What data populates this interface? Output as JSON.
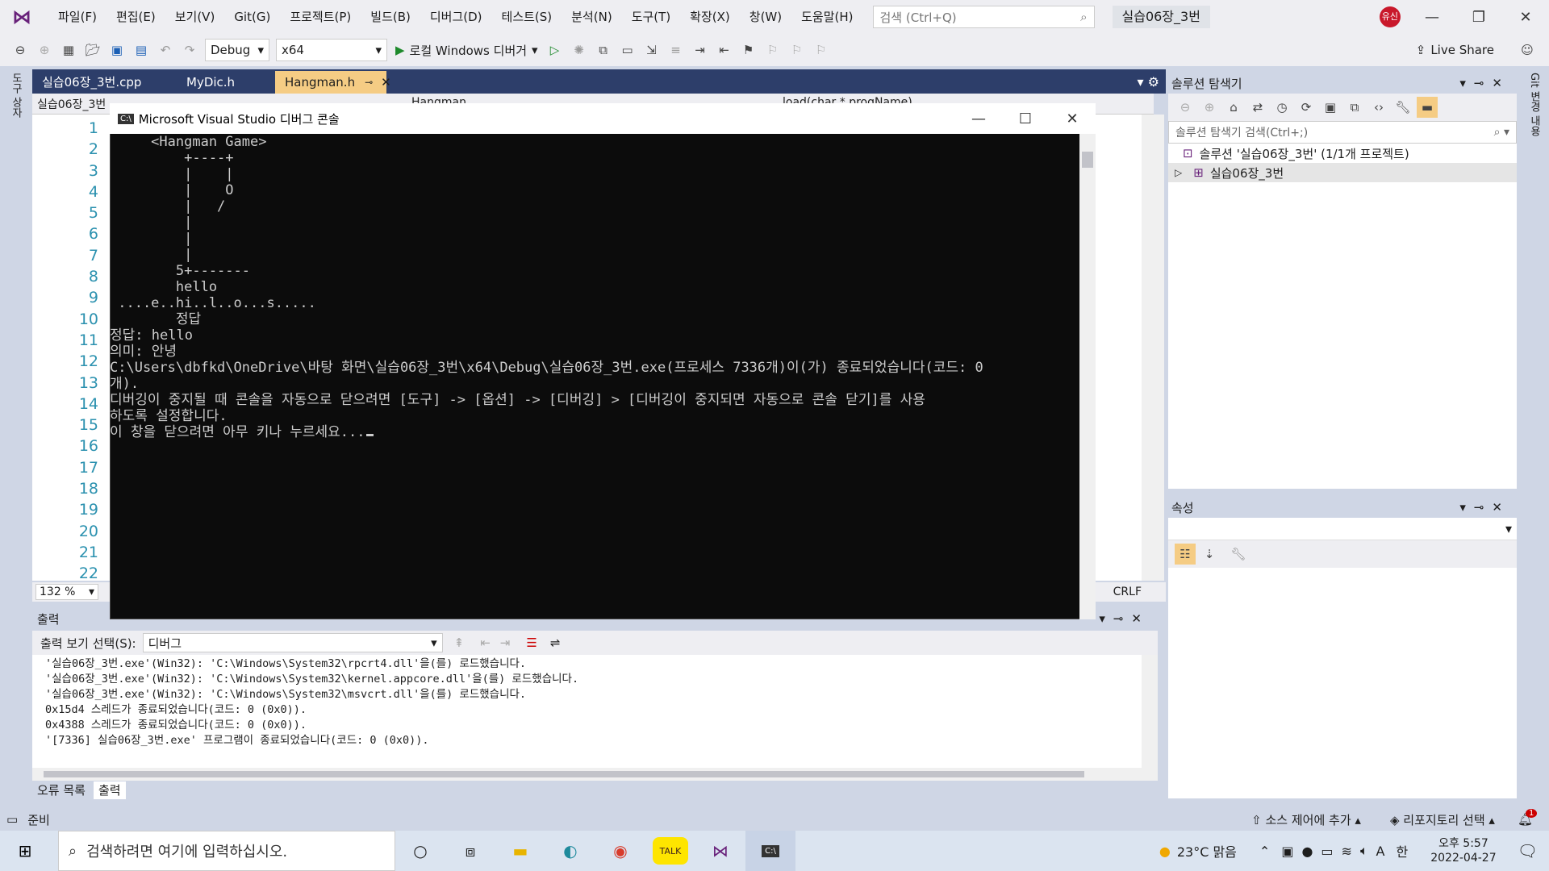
{
  "menu": [
    "파일(F)",
    "편집(E)",
    "보기(V)",
    "Git(G)",
    "프로젝트(P)",
    "빌드(B)",
    "디버그(D)",
    "테스트(S)",
    "분석(N)",
    "도구(T)",
    "확장(X)",
    "창(W)",
    "도움말(H)"
  ],
  "search": {
    "placeholder": "검색 (Ctrl+Q)"
  },
  "project_name": "실습06장_3번",
  "avatar_label": "유신",
  "toolbar": {
    "config": "Debug",
    "platform": "x64",
    "run_label": "로컬 Windows 디버거",
    "live_share": "Live Share"
  },
  "left_strip_label": "도구 상자",
  "right_strip_label": "Git 변경 내용",
  "tabs": [
    {
      "label": "실습06장_3번.cpp"
    },
    {
      "label": "MyDic.h"
    },
    {
      "label": "Hangman.h",
      "active": true
    }
  ],
  "nav": {
    "project": "실습06장_3번",
    "scope": "Hangman",
    "member": "load(char * progName)"
  },
  "line_numbers": [
    "1",
    "2",
    "3",
    "4",
    "5",
    "6",
    "7",
    "8",
    "9",
    "10",
    "11",
    "12",
    "13",
    "14",
    "15",
    "16",
    "17",
    "18",
    "19",
    "20",
    "21",
    "22"
  ],
  "editor_status": {
    "zoom": "132 %",
    "eol": "CRLF"
  },
  "console": {
    "title": "Microsoft Visual Studio 디버그 콘솔",
    "lines": [
      "     <Hangman Game>",
      "         +----+",
      "         |    |",
      "         |    O",
      "         |   /",
      "         |",
      "         |",
      "         |",
      "        5+-------",
      "",
      "        hello",
      "",
      " ....e..hi..l..o...s.....",
      "        정답",
      "",
      "정답: hello",
      "의미: 안녕",
      "",
      "C:\\Users\\dbfkd\\OneDrive\\바탕 화면\\실습06장_3번\\x64\\Debug\\실습06장_3번.exe(프로세스 7336개)이(가) 종료되었습니다(코드: 0",
      "개).",
      "디버깅이 중지될 때 콘솔을 자동으로 닫으려면 [도구] -> [옵션] -> [디버깅] > [디버깅이 중지되면 자동으로 콘솔 닫기]를 사용",
      "하도록 설정합니다.",
      "이 창을 닫으려면 아무 키나 누르세요..."
    ]
  },
  "output": {
    "title": "출력",
    "source_label": "출력 보기 선택(S):",
    "source_value": "디버그",
    "lines": [
      "'실습06장_3번.exe'(Win32): 'C:\\Windows\\System32\\rpcrt4.dll'을(를) 로드했습니다.",
      "'실습06장_3번.exe'(Win32): 'C:\\Windows\\System32\\kernel.appcore.dll'을(를) 로드했습니다.",
      "'실습06장_3번.exe'(Win32): 'C:\\Windows\\System32\\msvcrt.dll'을(를) 로드했습니다.",
      "0x15d4 스레드가 종료되었습니다(코드: 0 (0x0)).",
      "0x4388 스레드가 종료되었습니다(코드: 0 (0x0)).",
      "'[7336] 실습06장_3번.exe' 프로그램이 종료되었습니다(코드: 0 (0x0))."
    ]
  },
  "bottom_tabs": [
    "오류 목록",
    "출력"
  ],
  "solution_explorer": {
    "title": "솔루션 탐색기",
    "search_placeholder": "솔루션 탐색기 검색(Ctrl+;)",
    "solution": "솔루션 '실습06장_3번' (1/1개 프로젝트)",
    "project": "실습06장_3번"
  },
  "properties": {
    "title": "속성"
  },
  "statusbar": {
    "ready": "준비",
    "source_control": "소스 제어에 추가",
    "repository": "리포지토리 선택",
    "notifications": "1"
  },
  "taskbar": {
    "search_placeholder": "검색하려면 여기에 입력하십시오.",
    "weather": "23°C 맑음",
    "ime": "한",
    "time": "오후 5:57",
    "date": "2022-04-27"
  }
}
